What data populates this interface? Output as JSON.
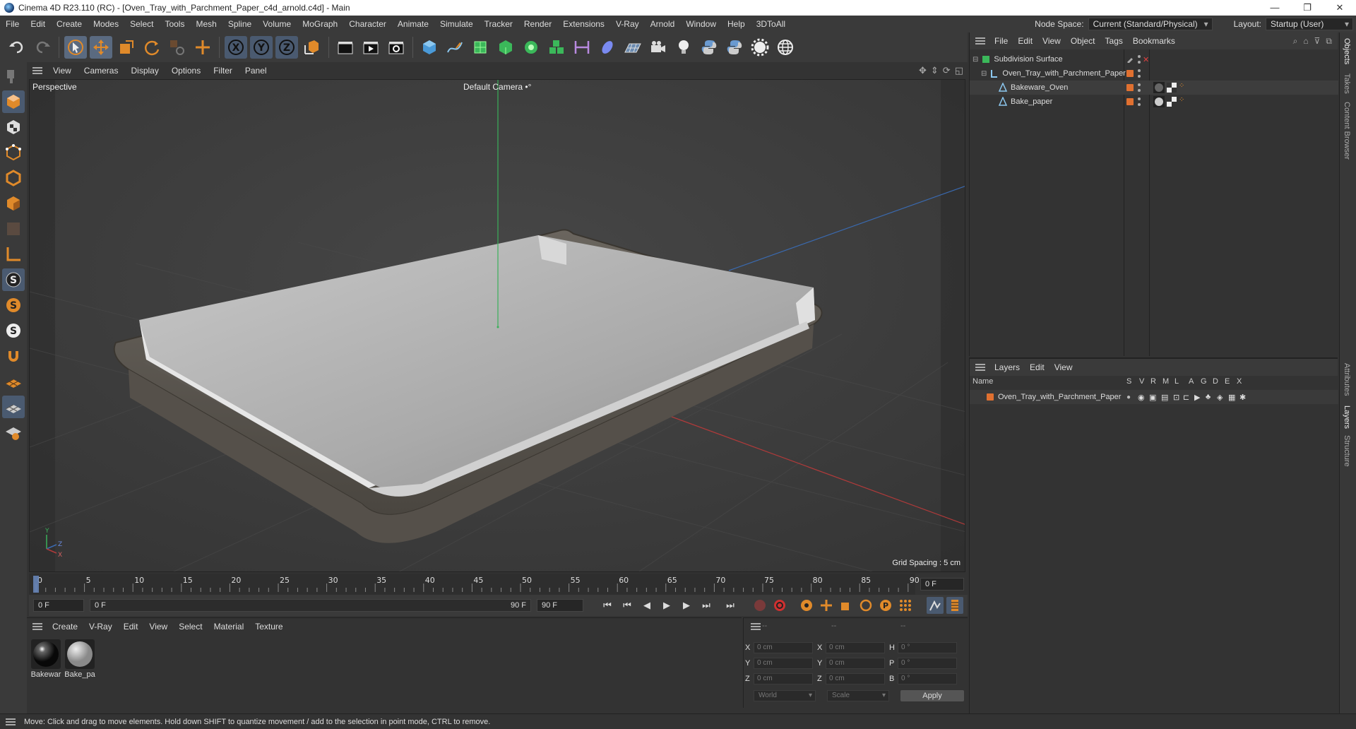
{
  "window": {
    "title": "Cinema 4D R23.110 (RC) - [Oven_Tray_with_Parchment_Paper_c4d_arnold.c4d] - Main",
    "controls": [
      "—",
      "❐",
      "✕"
    ]
  },
  "menu": {
    "items": [
      "File",
      "Edit",
      "Create",
      "Modes",
      "Select",
      "Tools",
      "Mesh",
      "Spline",
      "Volume",
      "MoGraph",
      "Character",
      "Animate",
      "Simulate",
      "Tracker",
      "Render",
      "Extensions",
      "V-Ray",
      "Arnold",
      "Window",
      "Help",
      "3DToAll"
    ],
    "node_space_label": "Node Space:",
    "node_space_value": "Current (Standard/Physical)",
    "layout_label": "Layout:",
    "layout_value": "Startup (User)"
  },
  "viewport": {
    "menu": [
      "View",
      "Cameras",
      "Display",
      "Options",
      "Filter",
      "Panel"
    ],
    "label": "Perspective",
    "camera": "Default Camera",
    "camera_suffix": "•°",
    "grid_spacing": "Grid Spacing : 5 cm",
    "axis": {
      "y": "Y",
      "z": "Z",
      "x": "X"
    }
  },
  "timeline": {
    "ticks": [
      "0",
      "5",
      "10",
      "15",
      "20",
      "25",
      "30",
      "35",
      "40",
      "45",
      "50",
      "55",
      "60",
      "65",
      "70",
      "75",
      "80",
      "85",
      "90"
    ],
    "current_frame": "0 F",
    "start": "0 F",
    "range_start": "0 F",
    "range_end": "90 F",
    "end": "90 F"
  },
  "materials": {
    "menu": [
      "Create",
      "V-Ray",
      "Edit",
      "View",
      "Select",
      "Material",
      "Texture"
    ],
    "items": [
      {
        "name": "Bakewar"
      },
      {
        "name": "Bake_pa"
      }
    ]
  },
  "coords": {
    "header": [
      "--",
      "--",
      "--"
    ],
    "rows": [
      {
        "l1": "X",
        "v1": "0 cm",
        "l2": "X",
        "v2": "0 cm",
        "l3": "H",
        "v3": "0 °"
      },
      {
        "l1": "Y",
        "v1": "0 cm",
        "l2": "Y",
        "v2": "0 cm",
        "l3": "P",
        "v3": "0 °"
      },
      {
        "l1": "Z",
        "v1": "0 cm",
        "l2": "Z",
        "v2": "0 cm",
        "l3": "B",
        "v3": "0 °"
      }
    ],
    "mode": "World",
    "transform": "Scale",
    "apply": "Apply"
  },
  "status": {
    "text": "Move: Click and drag to move elements. Hold down SHIFT to quantize movement / add to the selection in point mode, CTRL to remove."
  },
  "objects": {
    "menu": [
      "File",
      "Edit",
      "View",
      "Object",
      "Tags",
      "Bookmarks"
    ],
    "tree": [
      {
        "name": "Subdivision Surface",
        "level": 0
      },
      {
        "name": "Oven_Tray_with_Parchment_Paper",
        "level": 1
      },
      {
        "name": "Bakeware_Oven",
        "level": 2
      },
      {
        "name": "Bake_paper",
        "level": 2
      }
    ]
  },
  "layers": {
    "menu": [
      "Layers",
      "Edit",
      "View"
    ],
    "columns": [
      "Name",
      "S",
      "V",
      "R",
      "M",
      "L",
      "A",
      "G",
      "D",
      "E",
      "X"
    ],
    "rows": [
      {
        "name": "Oven_Tray_with_Parchment_Paper",
        "color": "#e07030"
      }
    ]
  },
  "right_tabs": [
    "Objects",
    "Takes",
    "Content Browser",
    "Attributes",
    "Layers",
    "Structure"
  ]
}
